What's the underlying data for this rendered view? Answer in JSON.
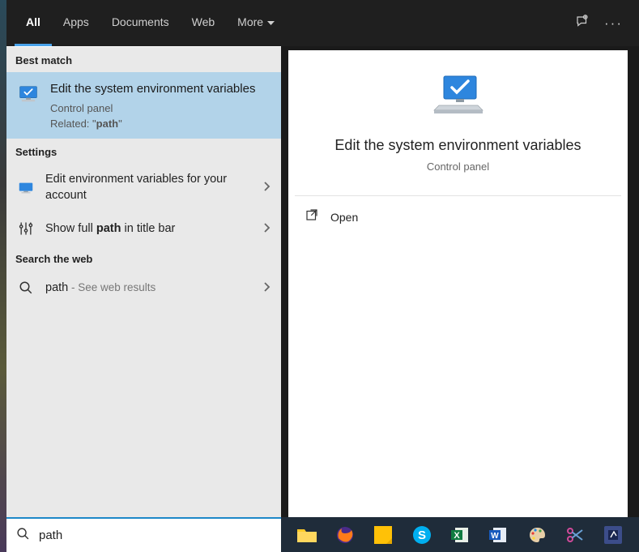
{
  "topTabs": {
    "all": "All",
    "apps": "Apps",
    "documents": "Documents",
    "web": "Web",
    "more": "More"
  },
  "sections": {
    "bestMatch": "Best match",
    "settings": "Settings",
    "searchWeb": "Search the web"
  },
  "bestMatch": {
    "title": "Edit the system environment variables",
    "subtitle": "Control panel",
    "relatedPrefix": "Related: \"",
    "relatedTerm": "path",
    "relatedSuffix": "\""
  },
  "settingsItems": {
    "item0_pre": "Edit environment variables for your account",
    "item1_pre": "Show full ",
    "item1_bold": "path",
    "item1_post": " in title bar"
  },
  "webItem": {
    "term": "path",
    "hint": " - See web results"
  },
  "preview": {
    "title": "Edit the system environment variables",
    "subtitle": "Control panel",
    "open": "Open"
  },
  "search": {
    "value": "path"
  }
}
